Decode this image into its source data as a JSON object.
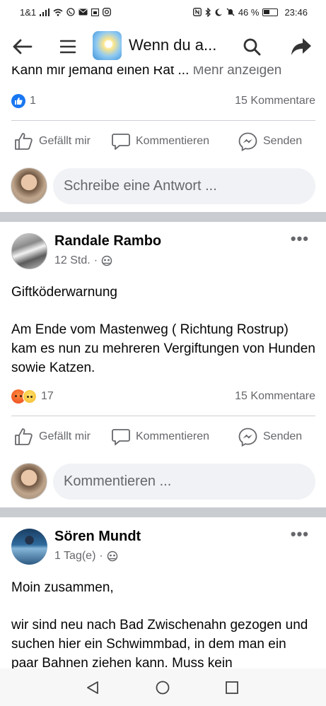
{
  "status_bar": {
    "carrier": "1&1",
    "battery": "46 %",
    "time": "23:46"
  },
  "header": {
    "title": "Wenn du a...",
    "icons": [
      "back-arrow-icon",
      "menu-icon",
      "search-icon",
      "share-icon"
    ]
  },
  "post1": {
    "truncated_text": "Kann mir jemand einen Rat ...",
    "see_more": "Mehr anzeigen",
    "reaction_count": "1",
    "comments": "15 Kommentare",
    "actions": {
      "like": "Gefällt mir",
      "comment": "Kommentieren",
      "send": "Senden"
    },
    "composer_placeholder": "Schreibe eine Antwort ..."
  },
  "post2": {
    "author": "Randale Rambo",
    "time": "12 Std.",
    "paragraph1": "Giftköderwarnung",
    "paragraph2": "Am Ende vom Mastenweg ( Richtung Rostrup) kam es nun zu mehreren Vergiftungen von Hunden sowie Katzen.",
    "reaction_count": "17",
    "comments": "15 Kommentare",
    "actions": {
      "like": "Gefällt mir",
      "comment": "Kommentieren",
      "send": "Senden"
    },
    "composer_placeholder": "Kommentieren ..."
  },
  "post3": {
    "author": "Sören Mundt",
    "time": "1 Tag(e)",
    "paragraph1": "Moin zusammen,",
    "paragraph2": "wir sind neu nach Bad Zwischenahn gezogen und suchen hier ein Schwimmbad, in dem man ein paar Bahnen ziehen kann. Muss kein"
  },
  "colors": {
    "accent": "#1877f2",
    "secondary_text": "#65676b",
    "input_bg": "#f0f2f5",
    "separator": "#c9ccd1"
  }
}
